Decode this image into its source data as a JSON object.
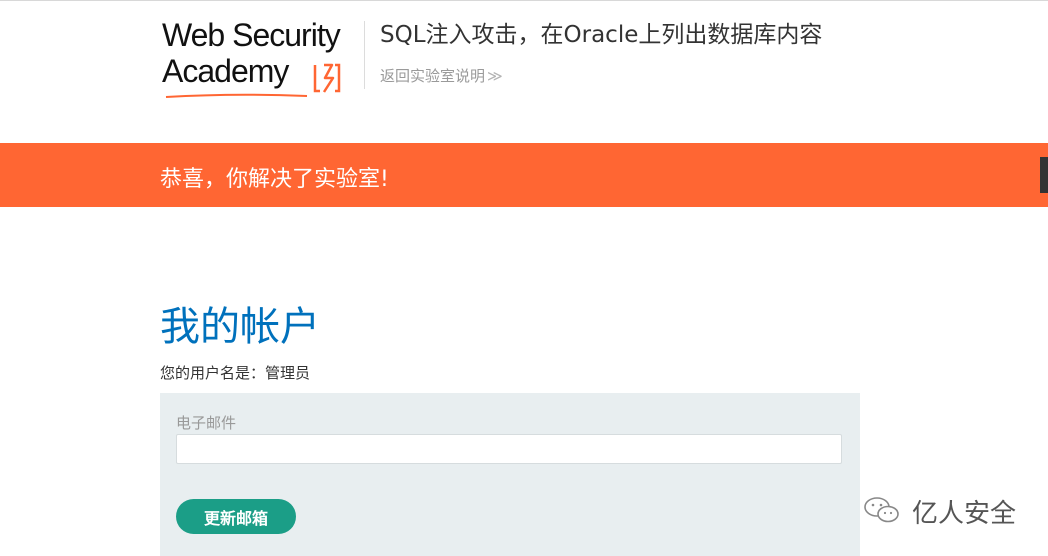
{
  "header": {
    "logo_line1": "Web Security",
    "logo_line2": "Academy",
    "lab_title": "SQL注入攻击，在Oracle上列出数据库内容",
    "back_link": "返回实验室说明",
    "back_chevron": "≫"
  },
  "banner": {
    "text": "恭喜，你解决了实验室!"
  },
  "main": {
    "heading": "我的帐户",
    "username_line": "您的用户名是：管理员",
    "email_label": "电子邮件",
    "email_value": "",
    "update_button": "更新邮箱"
  },
  "watermark": {
    "text": "亿人安全",
    "icon": "wechat-icon"
  },
  "colors": {
    "banner": "#ff6633",
    "heading": "#0071bc",
    "button": "#1b9e87",
    "panel": "#e8eef0",
    "logo_accent": "#ff6633"
  }
}
